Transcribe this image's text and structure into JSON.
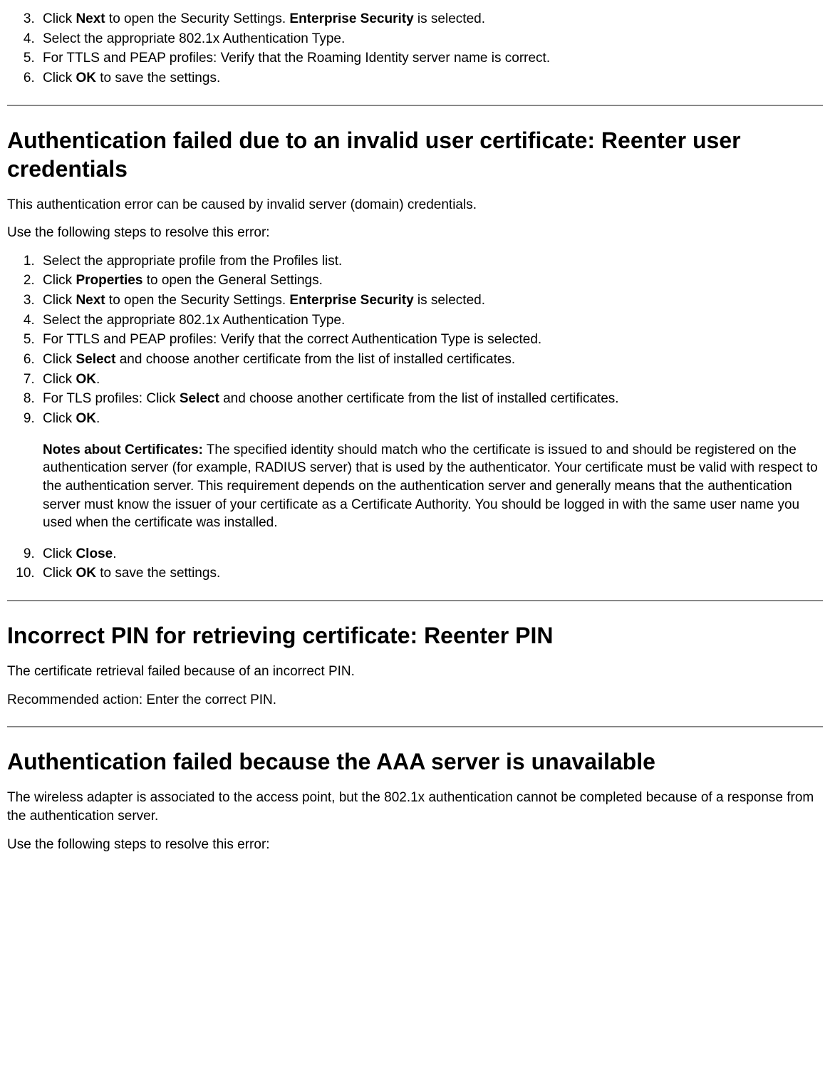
{
  "top_list": {
    "start": 3,
    "items": [
      {
        "pre": "Click ",
        "bold1": "Next",
        "mid": " to open the Security Settings. ",
        "bold2": "Enterprise Security",
        "post": " is selected."
      },
      {
        "pre": "Select the appropriate 802.1x Authentication Type."
      },
      {
        "pre": "For TTLS and PEAP profiles: Verify that the Roaming Identity server name is correct."
      },
      {
        "pre": "Click ",
        "bold1": "OK",
        "post": " to save the settings."
      }
    ]
  },
  "section1": {
    "heading": "Authentication failed due to an invalid user certificate: Reenter user credentials",
    "intro1": "This authentication error can be caused by invalid server (domain) credentials.",
    "intro2": "Use the following steps to resolve this error:",
    "list1": [
      {
        "pre": "Select the appropriate profile from the Profiles list."
      },
      {
        "pre": "Click ",
        "bold1": "Properties",
        "post": " to open the General Settings."
      },
      {
        "pre": "Click ",
        "bold1": "Next",
        "mid": " to open the Security Settings. ",
        "bold2": "Enterprise Security",
        "post": " is selected."
      },
      {
        "pre": "Select the appropriate 802.1x Authentication Type."
      },
      {
        "pre": "For TTLS and PEAP profiles: Verify that the correct Authentication Type is selected."
      },
      {
        "pre": "Click ",
        "bold1": "Select",
        "post": " and choose another certificate from the list of installed certificates."
      },
      {
        "pre": "Click ",
        "bold1": "OK",
        "post": "."
      },
      {
        "pre": "For TLS profiles: Click ",
        "bold1": "Select",
        "post": " and choose another certificate from the list of installed certificates."
      },
      {
        "pre": "Click ",
        "bold1": "OK",
        "post": "."
      }
    ],
    "note_label": "Notes about Certificates:",
    "note_body": " The specified identity should match who the certificate is issued to and should be registered on the authentication server (for example, RADIUS server) that is used by the authenticator. Your certificate must be valid with respect to the authentication server. This requirement depends on the authentication server and generally means that the authentication server must know the issuer of your certificate as a Certificate Authority. You should be logged in with the same user name you used when the certificate was installed.",
    "list2_start": 9,
    "list2": [
      {
        "pre": "Click ",
        "bold1": "Close",
        "post": "."
      },
      {
        "pre": "Click ",
        "bold1": "OK",
        "post": " to save the settings."
      }
    ]
  },
  "section2": {
    "heading": "Incorrect PIN for retrieving certificate: Reenter PIN",
    "p1": "The certificate retrieval failed because of an incorrect PIN.",
    "p2": "Recommended action: Enter the correct PIN."
  },
  "section3": {
    "heading": "Authentication failed because the AAA server is unavailable",
    "p1": "The wireless adapter is associated to the access point, but the 802.1x authentication cannot be completed because of a response from the authentication server.",
    "p2": "Use the following steps to resolve this error:"
  }
}
